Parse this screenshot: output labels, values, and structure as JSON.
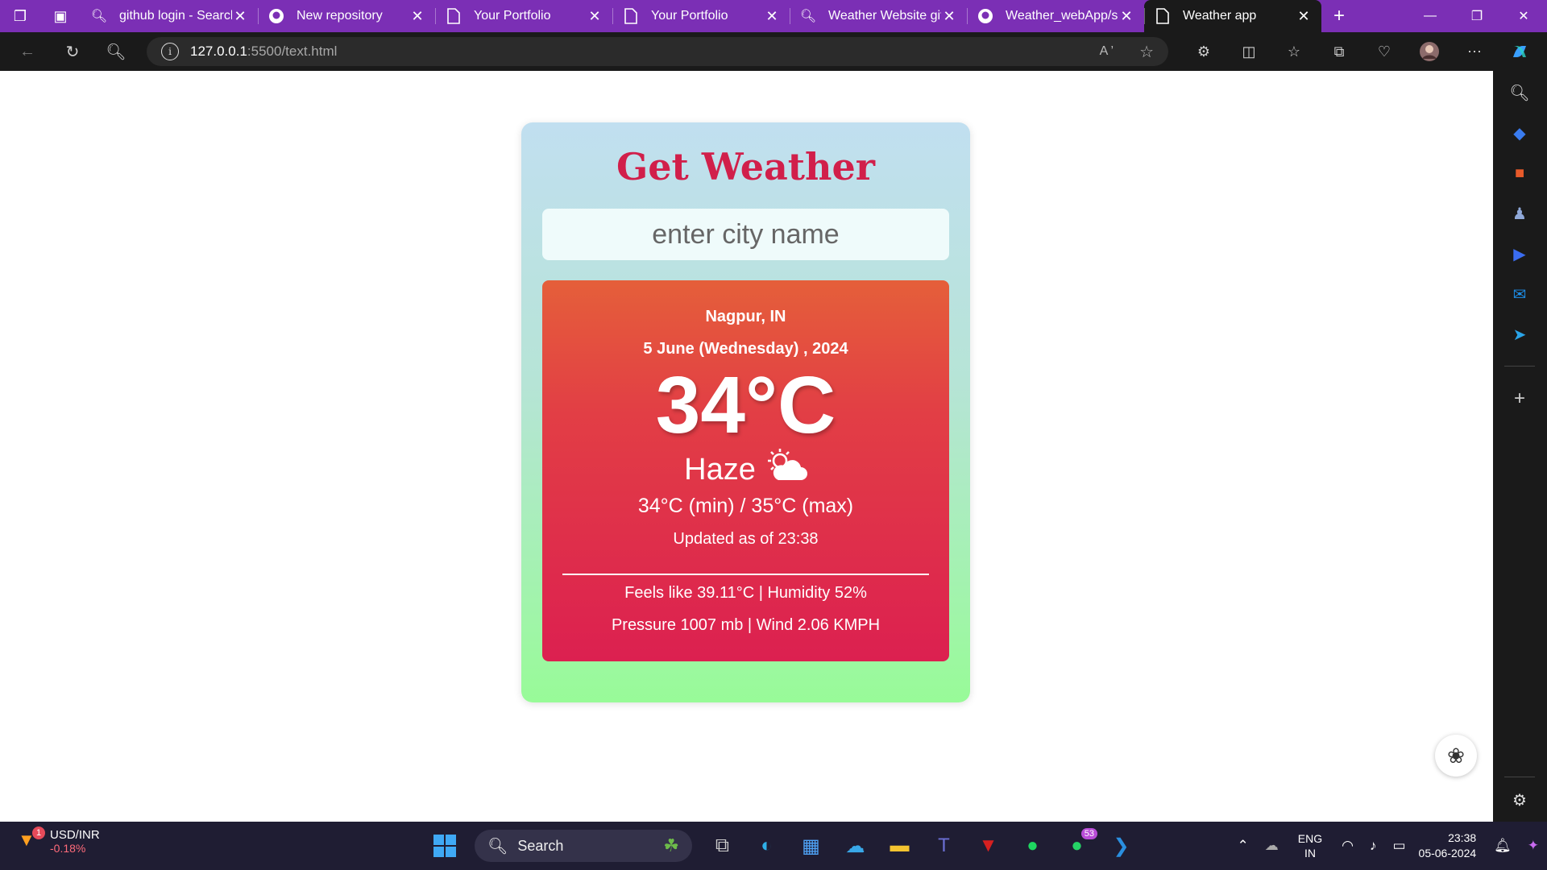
{
  "browser": {
    "tabs": [
      {
        "title": "github login - Search",
        "icon": "search-icon",
        "active": false
      },
      {
        "title": "New repository",
        "icon": "github-icon",
        "active": false
      },
      {
        "title": "Your Portfolio",
        "icon": "page-icon",
        "active": false
      },
      {
        "title": "Your Portfolio",
        "icon": "page-icon",
        "active": false
      },
      {
        "title": "Weather Website git",
        "icon": "search-icon",
        "active": false
      },
      {
        "title": "Weather_webApp/sc",
        "icon": "github-icon",
        "active": false
      },
      {
        "title": "Weather app",
        "icon": "page-icon",
        "active": true
      }
    ],
    "url_host": "127.0.0.1",
    "url_path": ":5500/text.html"
  },
  "app": {
    "title": "Get Weather",
    "search_placeholder": "enter city name",
    "location": "Nagpur, IN",
    "date": "5 June (Wednesday) , 2024",
    "temperature": "34°C",
    "condition": "Haze",
    "condition_icon": "sun-behind-cloud-icon",
    "min_max": "34°C (min) / 35°C (max)",
    "updated": "Updated as of 23:38",
    "feels_humidity": "Feels like 39.11°C | Humidity 52%",
    "pressure_wind": "Pressure 1007 mb | Wind 2.06 KMPH"
  },
  "taskbar": {
    "ticker_label": "USD/INR",
    "ticker_change": "-0.18%",
    "ticker_badge": "1",
    "search_label": "Search",
    "whatsapp_badge": "53",
    "lang_line1": "ENG",
    "lang_line2": "IN",
    "time": "23:38",
    "date": "05-06-2024"
  },
  "colors": {
    "tabstrip": "#7b2fb5",
    "title": "#d11f4a",
    "card_top": "#c1dff0",
    "card_bottom": "#98fb98",
    "weather_top": "#e55f3a",
    "weather_bottom": "#dc2050"
  }
}
